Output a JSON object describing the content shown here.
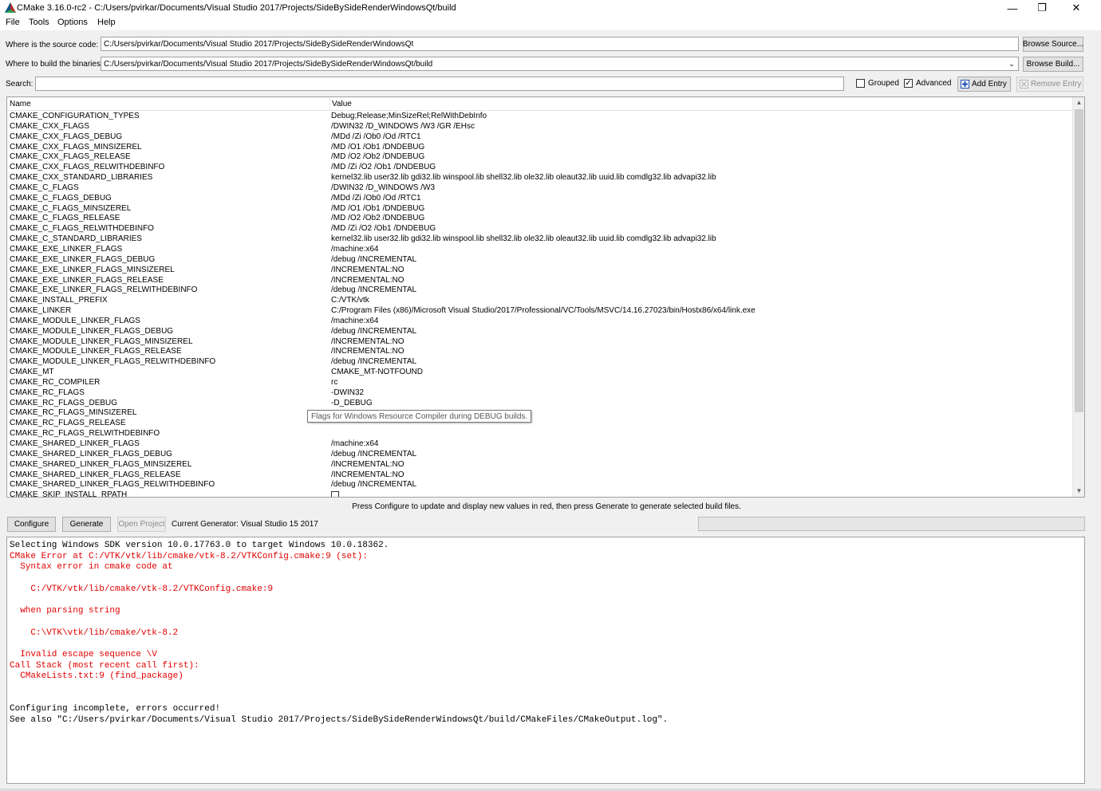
{
  "window": {
    "title": "CMake 3.16.0-rc2 - C:/Users/pvirkar/Documents/Visual Studio 2017/Projects/SideBySideRenderWindowsQt/build",
    "minimize": "—",
    "maximize": "❐",
    "close": "✕"
  },
  "menu": [
    "File",
    "Tools",
    "Options",
    "Help"
  ],
  "source": {
    "label": "Where is the source code:",
    "value": "C:/Users/pvirkar/Documents/Visual Studio 2017/Projects/SideBySideRenderWindowsQt",
    "button": "Browse Source..."
  },
  "build": {
    "label": "Where to build the binaries:",
    "value": "C:/Users/pvirkar/Documents/Visual Studio 2017/Projects/SideBySideRenderWindowsQt/build",
    "button": "Browse Build..."
  },
  "search": {
    "label": "Search:",
    "value": ""
  },
  "options": {
    "grouped_label": "Grouped",
    "grouped_checked": false,
    "advanced_label": "Advanced",
    "advanced_checked": true,
    "add_entry": "Add Entry",
    "remove_entry": "Remove Entry"
  },
  "table": {
    "col_name": "Name",
    "col_value": "Value",
    "rows": [
      {
        "name": "CMAKE_CONFIGURATION_TYPES",
        "value": "Debug;Release;MinSizeRel;RelWithDebInfo"
      },
      {
        "name": "CMAKE_CXX_FLAGS",
        "value": "/DWIN32 /D_WINDOWS /W3 /GR /EHsc"
      },
      {
        "name": "CMAKE_CXX_FLAGS_DEBUG",
        "value": "/MDd /Zi /Ob0 /Od /RTC1"
      },
      {
        "name": "CMAKE_CXX_FLAGS_MINSIZEREL",
        "value": "/MD /O1 /Ob1 /DNDEBUG"
      },
      {
        "name": "CMAKE_CXX_FLAGS_RELEASE",
        "value": "/MD /O2 /Ob2 /DNDEBUG"
      },
      {
        "name": "CMAKE_CXX_FLAGS_RELWITHDEBINFO",
        "value": "/MD /Zi /O2 /Ob1 /DNDEBUG"
      },
      {
        "name": "CMAKE_CXX_STANDARD_LIBRARIES",
        "value": "kernel32.lib user32.lib gdi32.lib winspool.lib shell32.lib ole32.lib oleaut32.lib uuid.lib comdlg32.lib advapi32.lib"
      },
      {
        "name": "CMAKE_C_FLAGS",
        "value": "/DWIN32 /D_WINDOWS /W3"
      },
      {
        "name": "CMAKE_C_FLAGS_DEBUG",
        "value": "/MDd /Zi /Ob0 /Od /RTC1"
      },
      {
        "name": "CMAKE_C_FLAGS_MINSIZEREL",
        "value": "/MD /O1 /Ob1 /DNDEBUG"
      },
      {
        "name": "CMAKE_C_FLAGS_RELEASE",
        "value": "/MD /O2 /Ob2 /DNDEBUG"
      },
      {
        "name": "CMAKE_C_FLAGS_RELWITHDEBINFO",
        "value": "/MD /Zi /O2 /Ob1 /DNDEBUG"
      },
      {
        "name": "CMAKE_C_STANDARD_LIBRARIES",
        "value": "kernel32.lib user32.lib gdi32.lib winspool.lib shell32.lib ole32.lib oleaut32.lib uuid.lib comdlg32.lib advapi32.lib"
      },
      {
        "name": "CMAKE_EXE_LINKER_FLAGS",
        "value": "/machine:x64"
      },
      {
        "name": "CMAKE_EXE_LINKER_FLAGS_DEBUG",
        "value": "/debug /INCREMENTAL"
      },
      {
        "name": "CMAKE_EXE_LINKER_FLAGS_MINSIZEREL",
        "value": "/INCREMENTAL:NO"
      },
      {
        "name": "CMAKE_EXE_LINKER_FLAGS_RELEASE",
        "value": "/INCREMENTAL:NO"
      },
      {
        "name": "CMAKE_EXE_LINKER_FLAGS_RELWITHDEBINFO",
        "value": "/debug /INCREMENTAL"
      },
      {
        "name": "CMAKE_INSTALL_PREFIX",
        "value": "C:/VTK/vtk"
      },
      {
        "name": "CMAKE_LINKER",
        "value": "C:/Program Files (x86)/Microsoft Visual Studio/2017/Professional/VC/Tools/MSVC/14.16.27023/bin/Hostx86/x64/link.exe"
      },
      {
        "name": "CMAKE_MODULE_LINKER_FLAGS",
        "value": "/machine:x64"
      },
      {
        "name": "CMAKE_MODULE_LINKER_FLAGS_DEBUG",
        "value": "/debug /INCREMENTAL"
      },
      {
        "name": "CMAKE_MODULE_LINKER_FLAGS_MINSIZEREL",
        "value": "/INCREMENTAL:NO"
      },
      {
        "name": "CMAKE_MODULE_LINKER_FLAGS_RELEASE",
        "value": "/INCREMENTAL:NO"
      },
      {
        "name": "CMAKE_MODULE_LINKER_FLAGS_RELWITHDEBINFO",
        "value": "/debug /INCREMENTAL"
      },
      {
        "name": "CMAKE_MT",
        "value": "CMAKE_MT-NOTFOUND"
      },
      {
        "name": "CMAKE_RC_COMPILER",
        "value": "rc"
      },
      {
        "name": "CMAKE_RC_FLAGS",
        "value": "-DWIN32"
      },
      {
        "name": "CMAKE_RC_FLAGS_DEBUG",
        "value": "-D_DEBUG"
      },
      {
        "name": "CMAKE_RC_FLAGS_MINSIZEREL",
        "value": ""
      },
      {
        "name": "CMAKE_RC_FLAGS_RELEASE",
        "value": ""
      },
      {
        "name": "CMAKE_RC_FLAGS_RELWITHDEBINFO",
        "value": ""
      },
      {
        "name": "CMAKE_SHARED_LINKER_FLAGS",
        "value": "/machine:x64"
      },
      {
        "name": "CMAKE_SHARED_LINKER_FLAGS_DEBUG",
        "value": "/debug /INCREMENTAL"
      },
      {
        "name": "CMAKE_SHARED_LINKER_FLAGS_MINSIZEREL",
        "value": "/INCREMENTAL:NO"
      },
      {
        "name": "CMAKE_SHARED_LINKER_FLAGS_RELEASE",
        "value": "/INCREMENTAL:NO"
      },
      {
        "name": "CMAKE_SHARED_LINKER_FLAGS_RELWITHDEBINFO",
        "value": "/debug /INCREMENTAL"
      },
      {
        "name": "CMAKE_SKIP_INSTALL_RPATH",
        "value": "",
        "checkbox": true
      }
    ],
    "tooltip": "Flags for Windows Resource Compiler during DEBUG builds."
  },
  "hint": "Press Configure to update and display new values in red, then press Generate to generate selected build files.",
  "actions": {
    "configure": "Configure",
    "generate": "Generate",
    "open_project": "Open Project",
    "generator": "Current Generator: Visual Studio 15 2017"
  },
  "log": [
    {
      "text": "Selecting Windows SDK version 10.0.17763.0 to target Windows 10.0.18362.",
      "color": "black"
    },
    {
      "text": "CMake Error at C:/VTK/vtk/lib/cmake/vtk-8.2/VTKConfig.cmake:9 (set):",
      "color": "red"
    },
    {
      "text": "  Syntax error in cmake code at",
      "color": "red"
    },
    {
      "text": "",
      "color": "red"
    },
    {
      "text": "    C:/VTK/vtk/lib/cmake/vtk-8.2/VTKConfig.cmake:9",
      "color": "red"
    },
    {
      "text": "",
      "color": "red"
    },
    {
      "text": "  when parsing string",
      "color": "red"
    },
    {
      "text": "",
      "color": "red"
    },
    {
      "text": "    C:\\VTK\\vtk/lib/cmake/vtk-8.2",
      "color": "red"
    },
    {
      "text": "",
      "color": "red"
    },
    {
      "text": "  Invalid escape sequence \\V",
      "color": "red"
    },
    {
      "text": "Call Stack (most recent call first):",
      "color": "red"
    },
    {
      "text": "  CMakeLists.txt:9 (find_package)",
      "color": "red"
    },
    {
      "text": "",
      "color": "red"
    },
    {
      "text": "",
      "color": "red"
    },
    {
      "text": "Configuring incomplete, errors occurred!",
      "color": "black"
    },
    {
      "text": "See also \"C:/Users/pvirkar/Documents/Visual Studio 2017/Projects/SideBySideRenderWindowsQt/build/CMakeFiles/CMakeOutput.log\".",
      "color": "black"
    }
  ],
  "colors": {
    "error_text": "#e00000",
    "window_bg": "#f0f0f0"
  }
}
